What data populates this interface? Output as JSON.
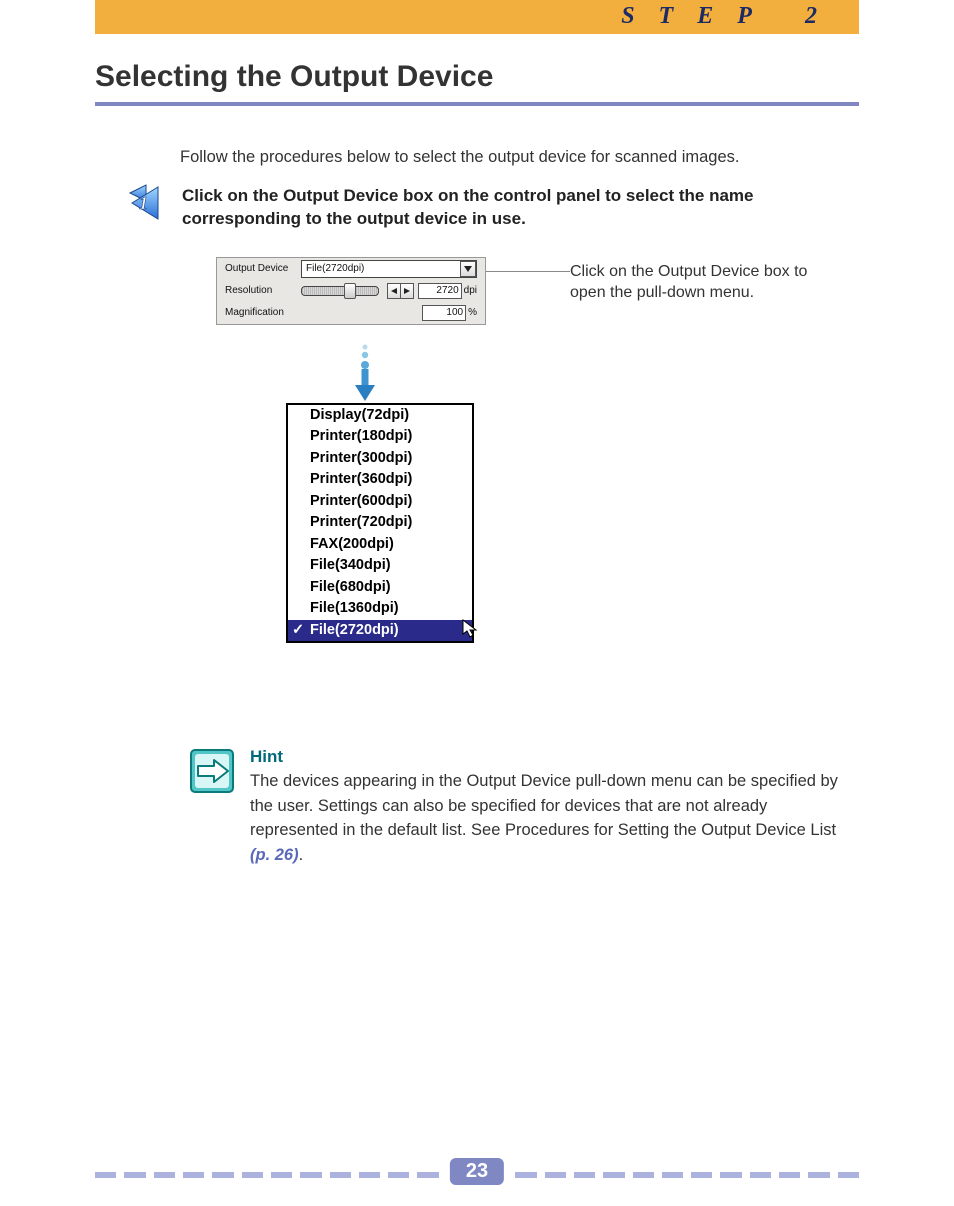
{
  "header": {
    "step_label": "STEP 2"
  },
  "title": "Selecting the Output Device",
  "intro": "Follow the procedures below to select the output device for scanned images.",
  "instruction": {
    "number": "1",
    "text": "Click on the Output Device box on the control panel to select the name corresponding to the output device in use."
  },
  "panel": {
    "rows": {
      "output_device": {
        "label": "Output Device",
        "value": "File(2720dpi)"
      },
      "resolution": {
        "label": "Resolution",
        "value": "2720",
        "unit": "dpi"
      },
      "magnification": {
        "label": "Magnification",
        "value": "100",
        "unit": "%"
      }
    }
  },
  "callout": "Click on the Output Device box to open the pull-down menu.",
  "dropdown": {
    "items": [
      "Display(72dpi)",
      "Printer(180dpi)",
      "Printer(300dpi)",
      "Printer(360dpi)",
      "Printer(600dpi)",
      "Printer(720dpi)",
      "FAX(200dpi)",
      "File(340dpi)",
      "File(680dpi)",
      "File(1360dpi)",
      "File(2720dpi)"
    ],
    "selected_index": 10
  },
  "hint": {
    "title": "Hint",
    "text": "The devices appearing in the Output Device pull-down menu can be specified by the user. Settings can also be specified for devices that are not already represented in the default list. See Procedures for Setting the Output Device List",
    "page_ref": "(p. 26)",
    "suffix": "."
  },
  "footer": {
    "page_number": "23"
  }
}
